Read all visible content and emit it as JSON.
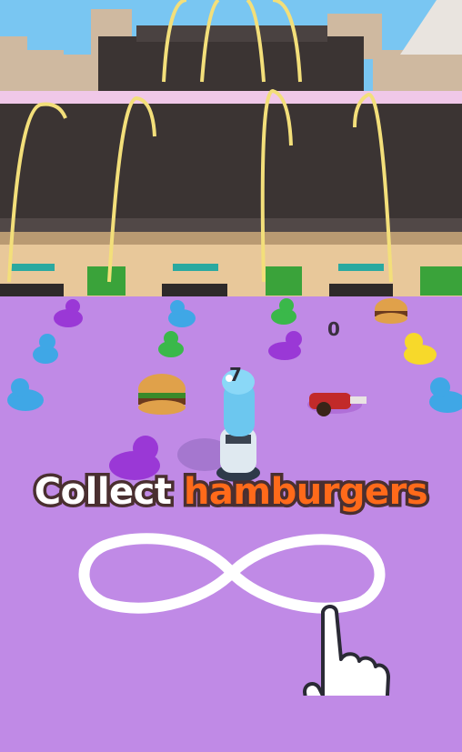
{
  "hud": {
    "score_enemy": "0",
    "score_player": "7"
  },
  "tutorial": {
    "word_1": "Collect",
    "word_2": "hamburgers",
    "gesture": "infinity-swipe-icon",
    "hand": "pointing-hand-icon"
  },
  "colors": {
    "floor": "#c08ae6",
    "text_white": "#ffffff",
    "text_orange": "#ff6a1a",
    "text_outline": "#4a2f30",
    "sky": "#79c6f2",
    "wall": "#3b3433",
    "ramp": "#f3df7a"
  }
}
